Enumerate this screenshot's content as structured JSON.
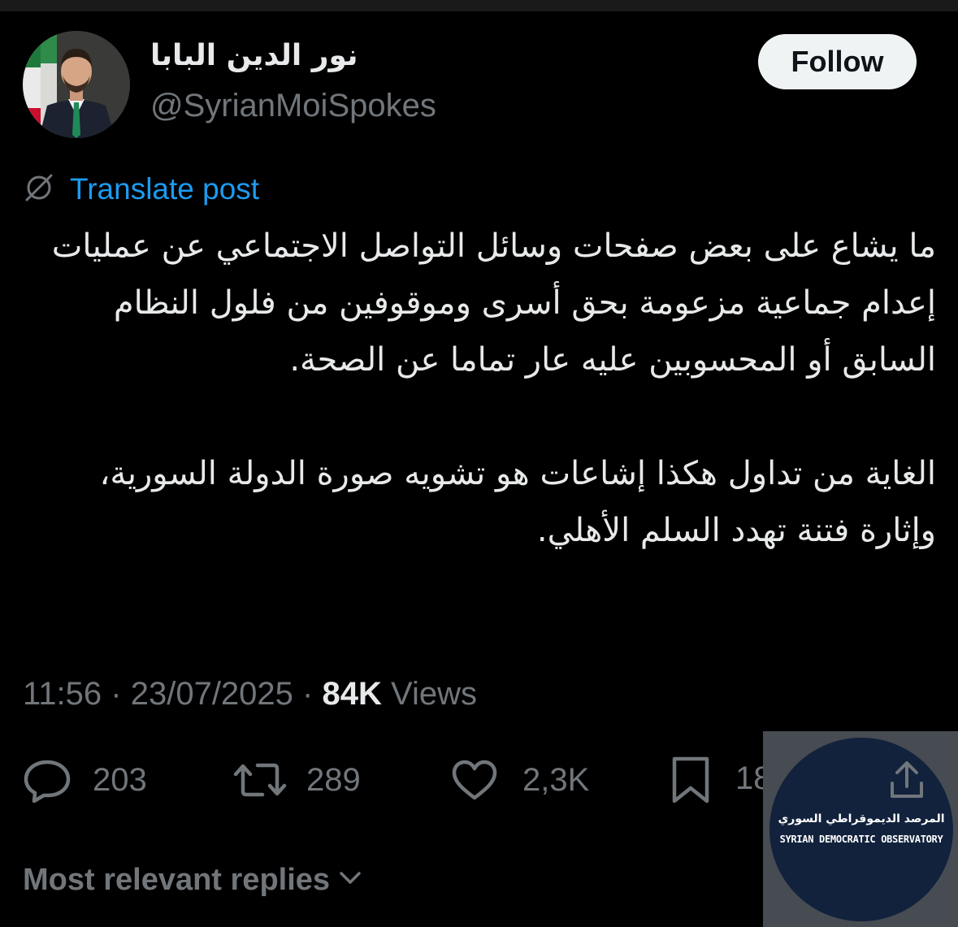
{
  "author": {
    "display_name": "نور الدين البابا",
    "handle": "@SyrianMoiSpokes"
  },
  "follow_label": "Follow",
  "translate_label": "Translate post",
  "post": {
    "paragraph_1": "ما يشاع على بعض صفحات وسائل التواصل الاجتماعي عن عمليات إعدام جماعية مزعومة بحق أسرى وموقوفين من فلول النظام السابق أو المحسوبين عليه عار تماما عن الصحة.",
    "paragraph_2": "الغاية من تداول هكذا إشاعات هو تشويه صورة الدولة السورية، وإثارة فتنة تهدد السلم الأهلي."
  },
  "meta": {
    "time": "11:56",
    "date": "23/07/2025",
    "views_count": "84K",
    "views_label": "Views",
    "separator": "·"
  },
  "actions": {
    "replies": "203",
    "reposts": "289",
    "likes": "2,3K",
    "bookmarks": "18"
  },
  "replies_sort_label": "Most relevant replies",
  "watermark": {
    "arabic": "المرصد الديموقراطي السوري",
    "english": "SYRIAN DEMOCRATIC OBSERVATORY"
  },
  "colors": {
    "background": "#000000",
    "primary_text": "#e7e9ea",
    "secondary_text": "#71767b",
    "link": "#1d9bf0",
    "follow_bg": "#eff3f4"
  },
  "icons": [
    "translate-icon",
    "reply-icon",
    "repost-icon",
    "like-icon",
    "bookmark-icon",
    "share-icon",
    "chevron-down-icon"
  ]
}
